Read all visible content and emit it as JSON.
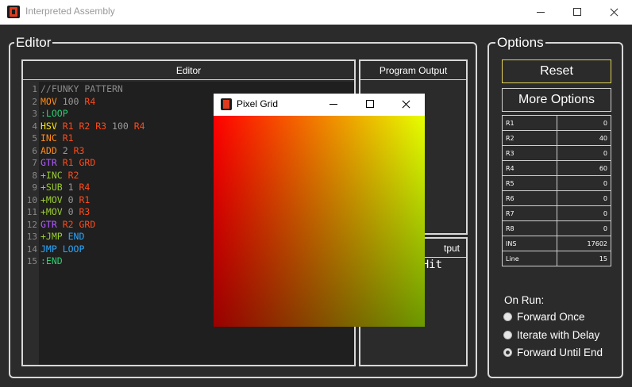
{
  "window": {
    "title": "Interpreted Assembly"
  },
  "editor_group": {
    "label": "Editor"
  },
  "editor_panel": {
    "title": "Editor",
    "lines": [
      {
        "num": "1",
        "tokens": [
          {
            "text": "//FUNKY PATTERN",
            "color": "#8a8a8a"
          }
        ]
      },
      {
        "num": "2",
        "tokens": [
          {
            "text": "MOV",
            "color": "#ff8c1a"
          },
          {
            "text": " 100",
            "color": "#9a9a9a"
          },
          {
            "text": " R4",
            "color": "#ff4a1a"
          }
        ]
      },
      {
        "num": "3",
        "tokens": [
          {
            "text": ":LOOP",
            "color": "#2ecc71"
          }
        ]
      },
      {
        "num": "4",
        "tokens": [
          {
            "text": "HSV",
            "color": "#ffe600"
          },
          {
            "text": " R1 R2 R3",
            "color": "#ff4a1a"
          },
          {
            "text": " 100",
            "color": "#9a9a9a"
          },
          {
            "text": " R4",
            "color": "#ff4a1a"
          }
        ]
      },
      {
        "num": "5",
        "tokens": [
          {
            "text": "INC",
            "color": "#ff8c1a"
          },
          {
            "text": " R1",
            "color": "#ff4a1a"
          }
        ]
      },
      {
        "num": "6",
        "tokens": [
          {
            "text": "ADD",
            "color": "#ff8c1a"
          },
          {
            "text": " 2",
            "color": "#9a9a9a"
          },
          {
            "text": " R3",
            "color": "#ff4a1a"
          }
        ]
      },
      {
        "num": "7",
        "tokens": [
          {
            "text": "GTR",
            "color": "#b05cff"
          },
          {
            "text": " R1 GRD",
            "color": "#ff4a1a"
          }
        ]
      },
      {
        "num": "8",
        "tokens": [
          {
            "text": "+INC",
            "color": "#9acd32"
          },
          {
            "text": " R2",
            "color": "#ff4a1a"
          }
        ]
      },
      {
        "num": "9",
        "tokens": [
          {
            "text": "+SUB",
            "color": "#9acd32"
          },
          {
            "text": " 1",
            "color": "#9a9a9a"
          },
          {
            "text": " R4",
            "color": "#ff4a1a"
          }
        ]
      },
      {
        "num": "10",
        "tokens": [
          {
            "text": "+MOV",
            "color": "#9acd32"
          },
          {
            "text": " 0",
            "color": "#9a9a9a"
          },
          {
            "text": " R1",
            "color": "#ff4a1a"
          }
        ]
      },
      {
        "num": "11",
        "tokens": [
          {
            "text": "+MOV",
            "color": "#9acd32"
          },
          {
            "text": " 0",
            "color": "#9a9a9a"
          },
          {
            "text": " R3",
            "color": "#ff4a1a"
          }
        ]
      },
      {
        "num": "12",
        "tokens": [
          {
            "text": "GTR",
            "color": "#b05cff"
          },
          {
            "text": " R2 GRD",
            "color": "#ff4a1a"
          }
        ]
      },
      {
        "num": "13",
        "tokens": [
          {
            "text": "+JMP",
            "color": "#9acd32"
          },
          {
            "text": " END",
            "color": "#29a8ff"
          }
        ]
      },
      {
        "num": "14",
        "tokens": [
          {
            "text": "JMP",
            "color": "#29a8ff"
          },
          {
            "text": " LOOP",
            "color": "#29a8ff"
          }
        ]
      },
      {
        "num": "15",
        "tokens": [
          {
            "text": ":END",
            "color": "#2ecc71"
          }
        ]
      }
    ]
  },
  "program_output": {
    "title": "Program Output"
  },
  "second_output": {
    "title_visible": "tput",
    "text_visible": "Hit"
  },
  "options_group": {
    "label": "Options"
  },
  "buttons": {
    "reset": "Reset",
    "more_options": "More Options"
  },
  "registers": [
    {
      "name": "R1",
      "value": "0"
    },
    {
      "name": "R2",
      "value": "40"
    },
    {
      "name": "R3",
      "value": "0"
    },
    {
      "name": "R4",
      "value": "60"
    },
    {
      "name": "R5",
      "value": "0"
    },
    {
      "name": "R6",
      "value": "0"
    },
    {
      "name": "R7",
      "value": "0"
    },
    {
      "name": "R8",
      "value": "0"
    },
    {
      "name": "INS",
      "value": "17602"
    },
    {
      "name": "Line",
      "value": "15"
    }
  ],
  "on_run": {
    "label": "On Run:",
    "options": [
      {
        "label": "Forward Once",
        "checked": false
      },
      {
        "label": "Iterate with Delay",
        "checked": false
      },
      {
        "label": "Forward Until End",
        "checked": true
      }
    ]
  },
  "pixel_grid": {
    "title": "Pixel Grid",
    "gradient": {
      "top_left": "#ff0000",
      "top_right": "#e6ff00",
      "bottom_left": "#990000",
      "bottom_right": "#6b9900"
    }
  },
  "colors": {
    "background": "#2b2b2b",
    "reset_border": "#e3d25a"
  }
}
